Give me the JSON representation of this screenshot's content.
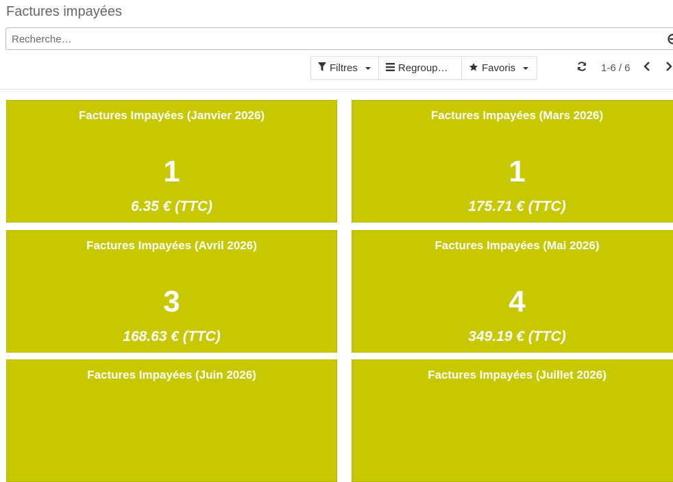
{
  "page": {
    "title": "Factures impayées"
  },
  "search": {
    "placeholder": "Recherche…"
  },
  "toolbar": {
    "filters_label": "Filtres",
    "groupby_label": "Regroup…",
    "favorites_label": "Favoris"
  },
  "pager": {
    "range": "1-6 / 6"
  },
  "cards": [
    {
      "title": "Factures Impayées (Janvier 2026)",
      "count": "1",
      "amount": "6.35 € (TTC)"
    },
    {
      "title": "Factures Impayées (Mars 2026)",
      "count": "1",
      "amount": "175.71 € (TTC)"
    },
    {
      "title": "Factures Impayées (Avril 2026)",
      "count": "3",
      "amount": "168.63 € (TTC)"
    },
    {
      "title": "Factures Impayées (Mai 2026)",
      "count": "4",
      "amount": "349.19 € (TTC)"
    },
    {
      "title": "Factures Impayées (Juin 2026)",
      "count": "",
      "amount": ""
    },
    {
      "title": "Factures Impayées (Juillet 2026)",
      "count": "",
      "amount": ""
    }
  ],
  "colors": {
    "card_bg": "#c8c800",
    "card_text": "#ffffff"
  },
  "icons": [
    "search-icon",
    "filter-icon",
    "list-icon",
    "star-icon",
    "refresh-icon",
    "chevron-left-icon",
    "chevron-right-icon"
  ]
}
